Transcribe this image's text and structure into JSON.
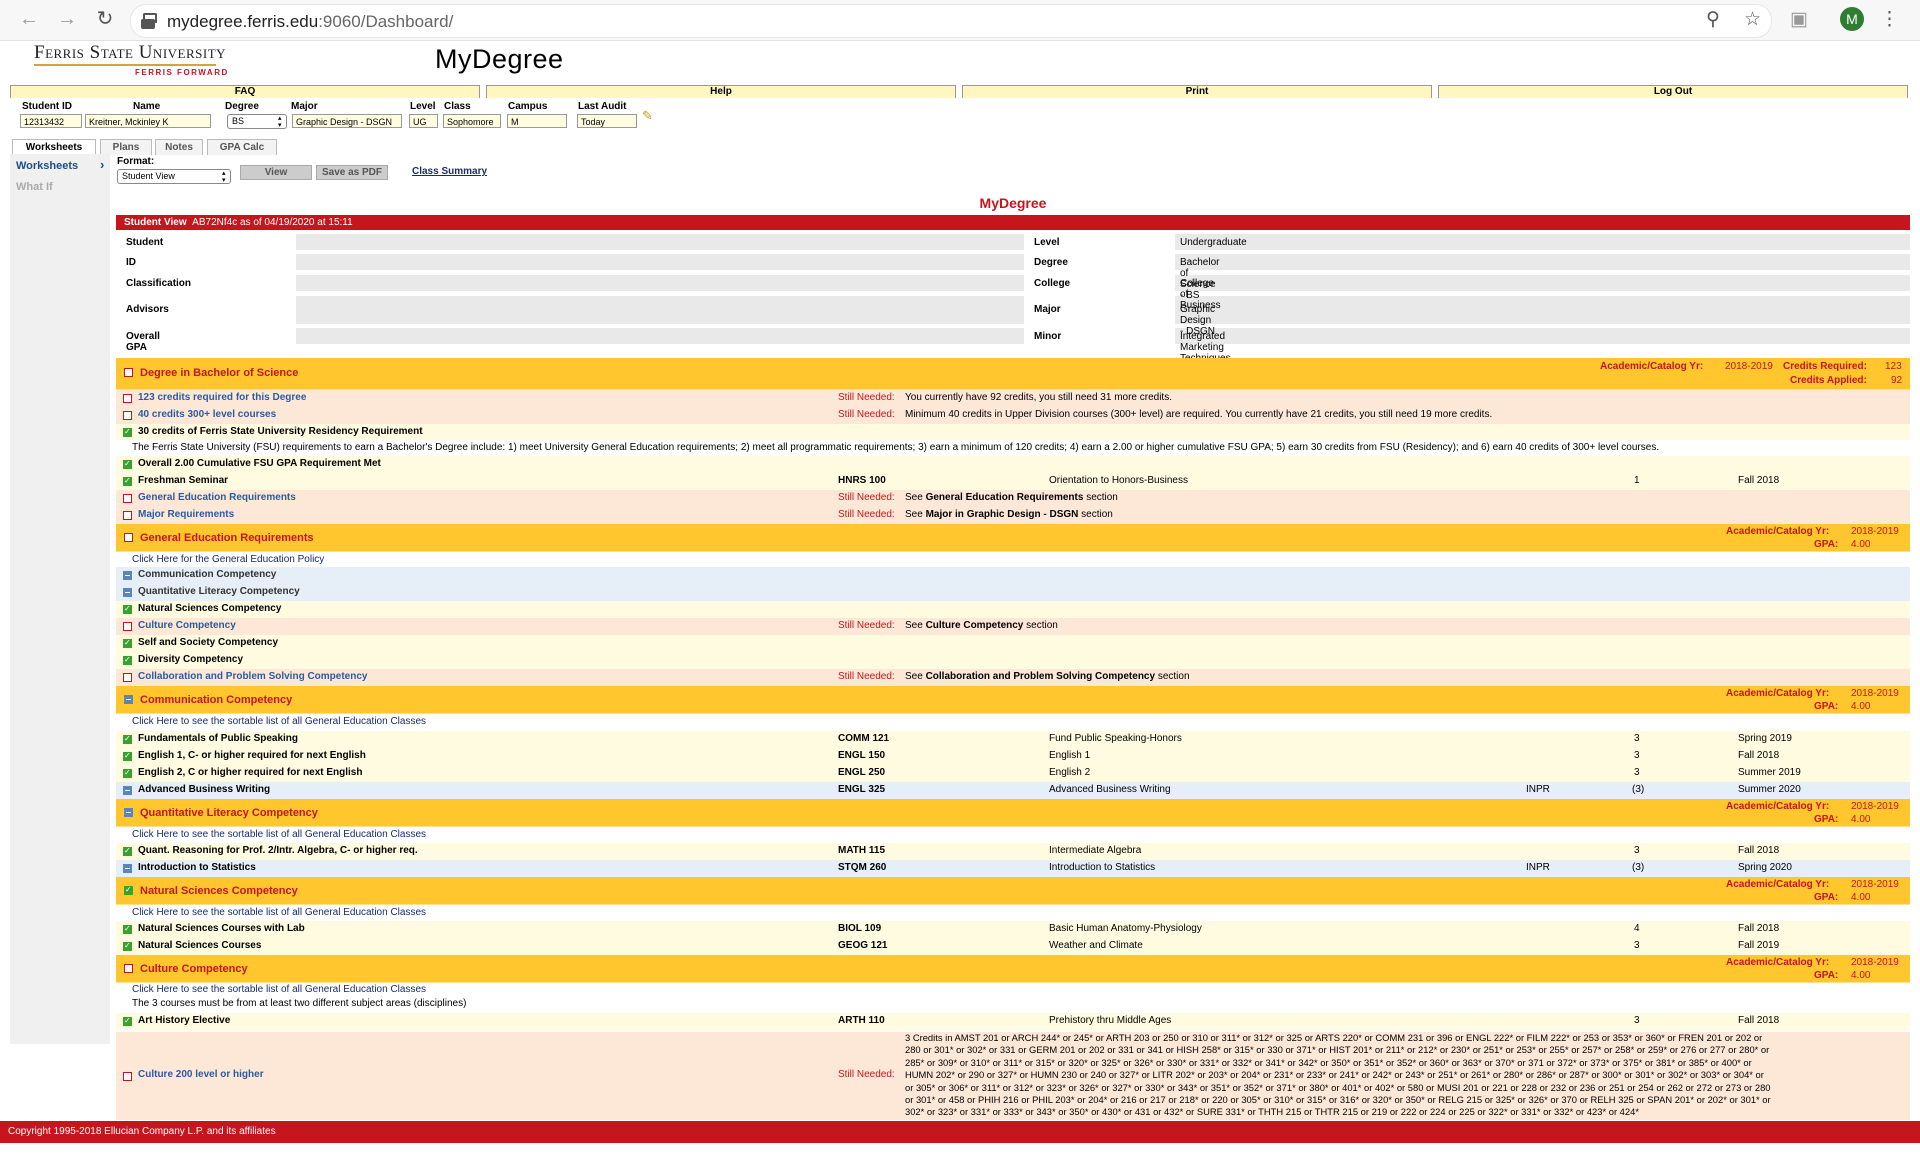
{
  "browser": {
    "url_host": "mydegree.ferris.edu",
    "url_rest": ":9060/Dashboard/",
    "avatar_letter": "M"
  },
  "header": {
    "logo_line1": "Ferris State University",
    "logo_line2": "FERRIS FORWARD",
    "app_title": "MyDegree"
  },
  "top_nav": [
    "FAQ",
    "Help",
    "Print",
    "Log Out"
  ],
  "student_fields": {
    "labels": {
      "id": "Student ID",
      "name": "Name",
      "degree": "Degree",
      "major": "Major",
      "level": "Level",
      "class": "Class",
      "campus": "Campus",
      "last_audit": "Last Audit"
    },
    "values": {
      "id": "12313432",
      "name": "Kreitner, Mckinley K",
      "degree": "BS",
      "major": "Graphic Design - DSGN",
      "level": "UG",
      "class": "Sophomore",
      "campus": "M",
      "last_audit": "Today"
    }
  },
  "tabs": [
    "Worksheets",
    "Plans",
    "Notes",
    "GPA Calc"
  ],
  "left_nav": [
    "Worksheets",
    "What If"
  ],
  "controls": {
    "format_label": "Format:",
    "format_value": "Student View",
    "view_button": "View",
    "pdf_button": "Save as PDF",
    "class_summary": "Class Summary"
  },
  "page_title": "MyDegree",
  "audit_bar": {
    "label": "Student View",
    "text": "AB72Nf4c as of 04/19/2020 at 15:11"
  },
  "student_info": {
    "left_labels": [
      "Student",
      "ID",
      "Classification",
      "Advisors",
      "Overall GPA"
    ],
    "right_labels": [
      "Level",
      "Degree",
      "College",
      "Major",
      "Minor"
    ],
    "right_values": [
      "Undergraduate",
      "Bachelor of Science - BS",
      "College of Business",
      "Graphic Design - DSGN",
      "Integrated Marketing Techniques - IMT"
    ]
  },
  "labels": {
    "catalog": "Academic/Catalog Yr:",
    "credits_required": "Credits Required:",
    "credits_applied": "Credits Applied:",
    "gpa": "GPA:",
    "still_needed": "Still Needed:",
    "see": "See",
    "section": "section"
  },
  "degree_block": {
    "title": "Degree in Bachelor of Science",
    "catalog_year": "2018-2019",
    "credits_required": "123",
    "credits_applied": "92",
    "rows": [
      {
        "text": "123 credits required for this Degree",
        "still": "You currently have 92 credits, you still need 31 more credits."
      },
      {
        "text": "40 credits 300+ level courses",
        "still": "Minimum 40 credits in Upper Division courses (300+ level) are required. You currently have 21 credits, you still need 19 more credits."
      },
      {
        "text": "30 credits of Ferris State University Residency Requirement"
      },
      {
        "note": "The Ferris State University (FSU) requirements to earn a Bachelor's Degree include: 1) meet University General Education requirements; 2) meet all programmatic requirements; 3) earn a minimum of 120 credits; 4) earn a 2.00 or higher cumulative FSU GPA; 5) earn 30 credits from FSU (Residency); and 6) earn 40 credits of 300+ level courses."
      },
      {
        "text": "Overall 2.00 Cumulative FSU GPA Requirement Met"
      },
      {
        "text": "Freshman Seminar",
        "course": "HNRS 100",
        "title": "Orientation to Honors-Business",
        "credits": "1",
        "term": "Fall 2018"
      },
      {
        "text": "General Education Requirements",
        "see": "General Education Requirements"
      },
      {
        "text": "Major Requirements",
        "see": "Major in Graphic Design - DSGN"
      }
    ]
  },
  "gened_block": {
    "title": "General Education Requirements",
    "catalog_year": "2018-2019",
    "gpa": "4.00",
    "policy_link": "Click Here for the General Education Policy",
    "rows": [
      {
        "text": "Communication Competency"
      },
      {
        "text": "Quantitative Literacy Competency"
      },
      {
        "text": "Natural Sciences Competency"
      },
      {
        "text": "Culture Competency",
        "see": "Culture Competency"
      },
      {
        "text": "Self and Society Competency"
      },
      {
        "text": "Diversity Competency"
      },
      {
        "text": "Collaboration and Problem Solving Competency",
        "see": "Collaboration and Problem Solving Competency"
      }
    ]
  },
  "sortable_link": "Click Here to see the sortable list of all General Education Classes",
  "comm_block": {
    "title": "Communication Competency",
    "catalog_year": "2018-2019",
    "gpa": "4.00",
    "rows": [
      {
        "text": "Fundamentals of Public Speaking",
        "course": "COMM 121",
        "title": "Fund Public Speaking-Honors",
        "credits": "3",
        "term": "Spring 2019"
      },
      {
        "text": "English 1, C- or higher required for next English",
        "course": "ENGL 150",
        "title": "English 1",
        "credits": "3",
        "term": "Fall 2018"
      },
      {
        "text": "English 2, C or higher required for next English",
        "course": "ENGL 250",
        "title": "English 2",
        "credits": "3",
        "term": "Summer 2019"
      },
      {
        "text": "Advanced Business Writing",
        "course": "ENGL 325",
        "title": "Advanced Business Writing",
        "grade": "INPR",
        "credits": "(3)",
        "term": "Summer 2020"
      }
    ]
  },
  "quant_block": {
    "title": "Quantitative Literacy Competency",
    "catalog_year": "2018-2019",
    "gpa": "4.00",
    "rows": [
      {
        "text": "Quant. Reasoning for Prof. 2/Intr. Algebra, C- or higher req.",
        "course": "MATH 115",
        "title": "Intermediate Algebra",
        "credits": "3",
        "term": "Fall 2018"
      },
      {
        "text": "Introduction to Statistics",
        "course": "STQM 260",
        "title": "Introduction to Statistics",
        "grade": "INPR",
        "credits": "(3)",
        "term": "Spring 2020"
      }
    ]
  },
  "natsci_block": {
    "title": "Natural Sciences Competency",
    "catalog_year": "2018-2019",
    "gpa": "4.00",
    "rows": [
      {
        "text": "Natural Sciences Courses with Lab",
        "course": "BIOL 109",
        "title": "Basic Human Anatomy-Physiology",
        "credits": "4",
        "term": "Fall 2018"
      },
      {
        "text": "Natural Sciences Courses",
        "course": "GEOG 121",
        "title": "Weather and Climate",
        "credits": "3",
        "term": "Fall 2019"
      }
    ]
  },
  "culture_block": {
    "title": "Culture Competency",
    "catalog_year": "2018-2019",
    "gpa": "4.00",
    "note": "The 3 courses must be from at least two different subject areas (disciplines)",
    "rows": [
      {
        "text": "Art History Elective",
        "course": "ARTH 110",
        "title": "Prehistory thru Middle Ages",
        "credits": "3",
        "term": "Fall 2018"
      },
      {
        "text": "Culture 200 level or higher"
      }
    ],
    "still_lines": [
      "3 Credits in AMST 201 or ARCH 244* or 245* or ARTH 203 or 250 or 310 or 311* or 312* or 325 or ARTS 220* or COMM 231 or 396 or ENGL 222* or FILM 222* or 253 or 353* or 360* or FREN 201 or 202 or",
      "280 or 301* or 302* or 331 or GERM 201 or 202 or 331 or 341 or HISH 258* or 315* or 330 or 371* or HIST 201* or 211* or 212* or 230* or 251* or 253* or 255* or 257* or 258* or 259* or 276 or 277 or 280* or",
      "285* or 309* or 310* or 311* or 315* or 320* or 325* or 326* or 330* or 331* or 332* or 341* or 342* or 350* or 351* or 352* or 360* or 363* or 370* or 371 or 372* or 373* or 375* or 381* or 385* or 400* or",
      "HUMN 202* or 290 or 327* or HUMN 230 or 240 or 327* or LITR 202* or 203* or 204* or 231* or 233* or 241* or 242* or 243* or 251* or 261* or 280* or 286* or 287* or 300* or 301* or 302* or 303* or 304* or",
      "or 305* or 306* or 311* or 312* or 323* or 326* or 327* or 330* or 343* or 351* or 352* or 371* or 380* or 401* or 402* or 580 or MUSI 201 or 221 or 228 or 232 or 236 or 251 or 254 or 262 or 272 or 273 or 280",
      "or 301* or 458 or PHIH 216 or PHIL 203* or 204* or 216 or 217 or 218* or 220 or 305* or 310* or 315* or 316* or 320* or 350* or RELG 215 or 325* or 326* or 370 or RELH 325 or SPAN 201* or 202* or 301* or",
      "302* or 323* or 331* or 333* or 343* or 350* or 430* or 431 or 432* or SURE 331* or THTH 215 or THTR 215 or 219 or 222 or 224 or 225 or 322* or 331* or 332* or 423* or 424*"
    ]
  },
  "footer": "Copyright 1995-2018 Ellucian Company L.P. and its affiliates"
}
